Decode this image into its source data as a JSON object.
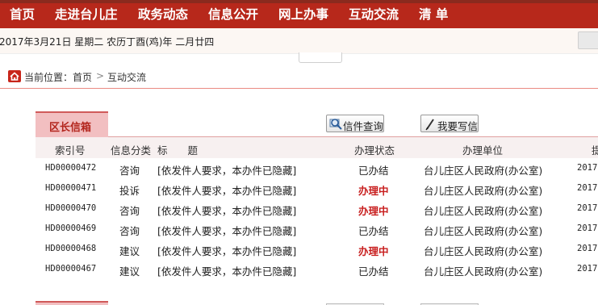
{
  "nav": {
    "items": [
      "首页",
      "走进台儿庄",
      "政务动态",
      "信息公开",
      "网上办事",
      "互动交流",
      "清 单"
    ]
  },
  "date_text": "2017年3月21日 星期二 农历丁酉(鸡)年 二月廿四",
  "breadcrumb": {
    "prefix": "当前位置：",
    "home": "首页",
    "separator": ">",
    "current": "互动交流"
  },
  "mailbox": {
    "tab_label": "区长信箱",
    "query_button": "信件查询",
    "write_button": "我要写信",
    "columns": [
      "索引号",
      "信息分类",
      "标　　题",
      "办理状态",
      "办理单位",
      "提"
    ],
    "rows": [
      {
        "id": "HD00000472",
        "category": "咨询",
        "title": "[依发件人要求，本办件已隐藏]",
        "status": "已办结",
        "unit": "台儿庄区人民政府(办公室)",
        "date": "2017"
      },
      {
        "id": "HD00000471",
        "category": "投诉",
        "title": "[依发件人要求，本办件已隐藏]",
        "status": "办理中",
        "unit": "台儿庄区人民政府(办公室)",
        "date": "2017"
      },
      {
        "id": "HD00000470",
        "category": "咨询",
        "title": "[依发件人要求，本办件已隐藏]",
        "status": "办理中",
        "unit": "台儿庄区人民政府(办公室)",
        "date": "2017"
      },
      {
        "id": "HD00000469",
        "category": "咨询",
        "title": "[依发件人要求，本办件已隐藏]",
        "status": "已办结",
        "unit": "台儿庄区人民政府(办公室)",
        "date": "2017"
      },
      {
        "id": "HD00000468",
        "category": "建议",
        "title": "[依发件人要求，本办件已隐藏]",
        "status": "办理中",
        "unit": "台儿庄区人民政府(办公室)",
        "date": "2017"
      },
      {
        "id": "HD00000467",
        "category": "建议",
        "title": "[依发件人要求，本办件已隐藏]",
        "status": "已办结",
        "unit": "台儿庄区人民政府(办公室)",
        "date": "2017"
      }
    ]
  },
  "colors": {
    "nav_bg": "#b7281b",
    "accent": "#b3261e",
    "pending_status": "#c81e1e",
    "tab_bg": "#f2bfc1"
  }
}
